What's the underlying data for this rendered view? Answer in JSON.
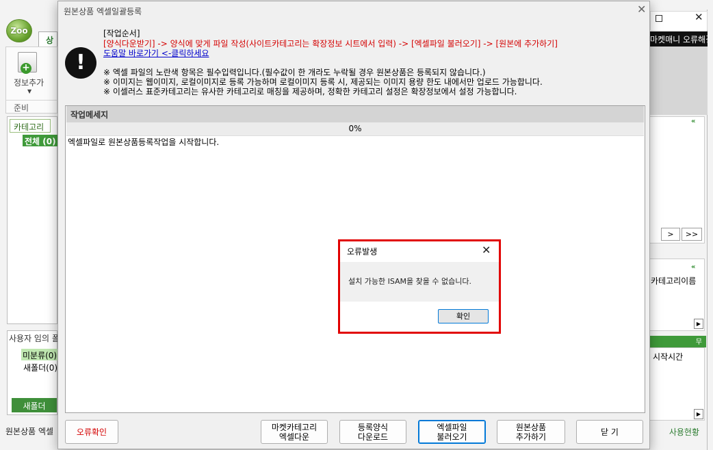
{
  "background_app": {
    "tab_label": "상품",
    "ribbon_button_label": "정보추가",
    "ribbon_group_label": "준비",
    "category_tab": "카테고리",
    "category_all": "전체 (0)",
    "user_folders_title": "사용자 임의 폴더",
    "folders": [
      "미분류(0)",
      "새폴더(0)"
    ],
    "new_folder_button": "새폴더",
    "status_text": "원본상품 엑셀",
    "right_header": "마켓매니 오류해결",
    "nav_next": ">",
    "nav_last": ">>",
    "right_category_label": "카테고리이름",
    "right_start_time": "시작시간",
    "usage_label": "사용현황",
    "green_bar_text": "무"
  },
  "dialog": {
    "title": "원본상품 엑셀일괄등록",
    "instructions": {
      "heading": "[작업순서]",
      "steps": "[양식다운받기] -> 양식에 맞게 파일 작성(사이트카테고리는 확장정보 시트에서 입력) -> [엑셀파일 불러오기] -> [원본에 추가하기]",
      "help_link": "도움말 바로가기 <-클릭하세요",
      "note1": "※ 엑셀 파일의 노란색 항목은 필수입력입니다.(필수값이 한 개라도 누락될 경우 원본상품은 등록되지 않습니다.)",
      "note2": "※ 이미지는 웹이미지, 로컬이미지로 등록 가능하며 로컬이미지 등록 시, 제공되는 이미지 용량 한도 내에서만 업로드 가능합니다.",
      "note3": "※ 이셀러스 표준카테고리는 유사한 카테고리로 매칭을 제공하며, 정확한 카테고리 설정은 확장정보에서 설정 가능합니다."
    },
    "message_panel": {
      "header": "작업메세지",
      "progress_text": "0%",
      "progress_value": 0,
      "log": "엑셀파일로 원본상품등록작업을 시작합니다."
    },
    "buttons": {
      "error_check": "오류확인",
      "market_category_line1": "마켓카테고리",
      "market_category_line2": "엑셀다운",
      "register_form_line1": "등록양식",
      "register_form_line2": "다운로드",
      "excel_load_line1": "엑셀파일",
      "excel_load_line2": "불러오기",
      "add_original_line1": "원본상품",
      "add_original_line2": "추가하기",
      "close": "닫 기"
    }
  },
  "error_dialog": {
    "title": "오류발생",
    "message": "설치 가능한 ISAM을 찾을 수 없습니다.",
    "ok_button": "확인"
  }
}
